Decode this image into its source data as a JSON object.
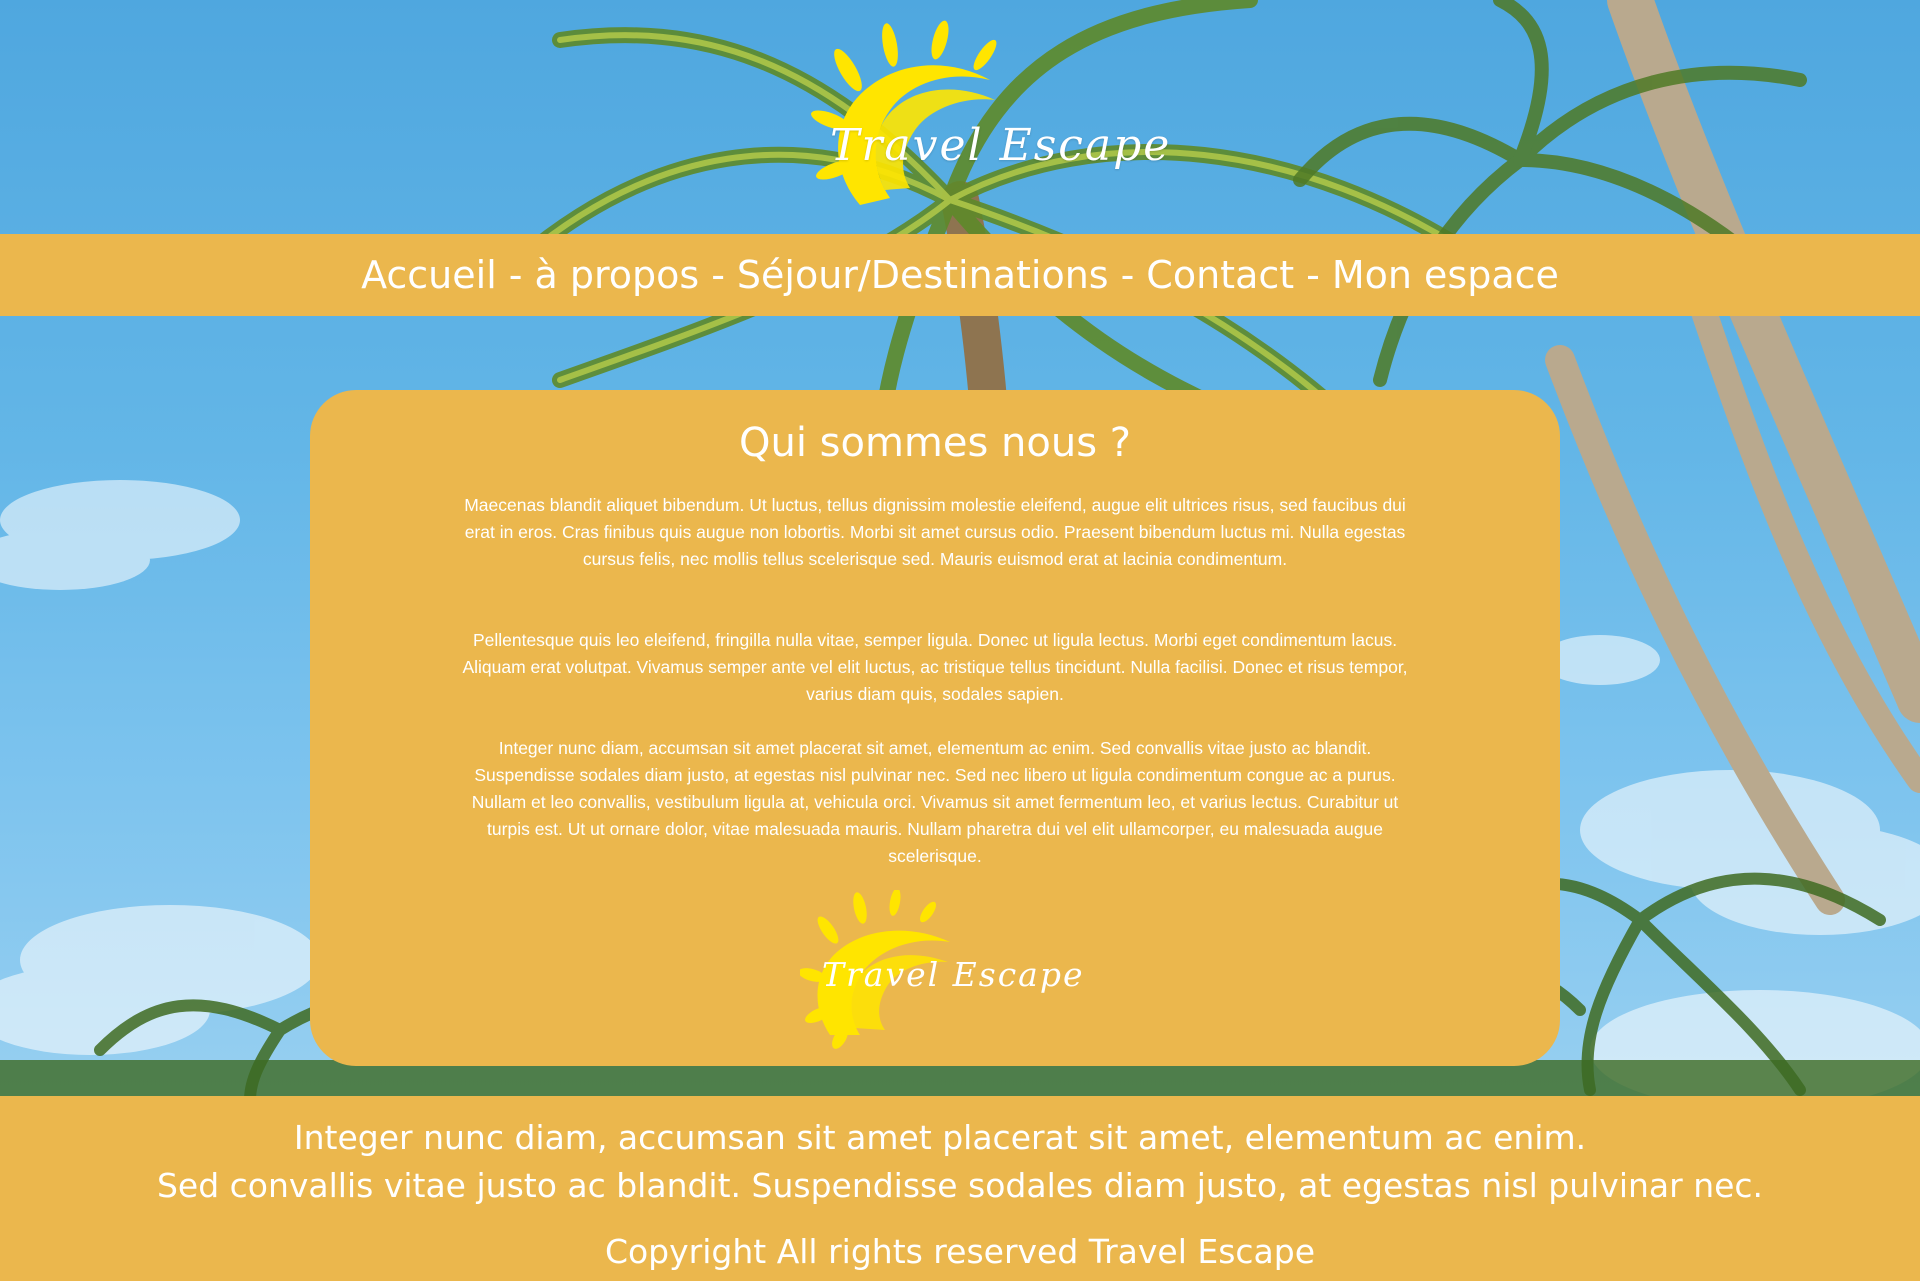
{
  "brand": {
    "name": "Travel Escape",
    "accent_color": "#ebb74d",
    "logo_sun_color": "#ffe500"
  },
  "nav": {
    "items": [
      {
        "label": "Accueil"
      },
      {
        "label": "à propos"
      },
      {
        "label": "Séjour/Destinations"
      },
      {
        "label": "Contact"
      },
      {
        "label": "Mon espace"
      }
    ],
    "separator": "-"
  },
  "main": {
    "title": "Qui sommes nous ?",
    "paragraphs": [
      "Maecenas blandit aliquet bibendum. Ut luctus, tellus dignissim molestie eleifend, augue elit ultrices risus, sed faucibus dui erat in eros. Cras finibus quis augue non lobortis. Morbi sit amet cursus odio. Praesent bibendum luctus mi. Nulla egestas cursus felis, nec mollis tellus scelerisque sed. Mauris euismod erat at lacinia condimentum.",
      "Pellentesque quis leo eleifend, fringilla nulla vitae, semper ligula. Donec ut ligula lectus. Morbi eget condimentum lacus. Aliquam erat volutpat. Vivamus semper ante vel elit luctus, ac tristique tellus tincidunt. Nulla facilisi. Donec et risus tempor, varius diam quis, sodales sapien.",
      "Integer nunc diam, accumsan sit amet placerat sit amet, elementum ac enim. Sed convallis vitae justo ac blandit. Suspendisse sodales diam justo, at egestas nisl pulvinar nec. Sed nec libero ut ligula condimentum congue ac a purus. Nullam et leo convallis, vestibulum ligula at, vehicula orci. Vivamus sit amet fermentum leo, et varius lectus. Curabitur ut turpis est. Ut ut ornare dolor, vitae malesuada mauris. Nullam pharetra dui vel elit ullamcorper, eu malesuada augue scelerisque."
    ]
  },
  "footer": {
    "line1": "Integer nunc diam, accumsan sit amet placerat sit amet, elementum ac enim.",
    "line2": "Sed convallis vitae justo ac blandit. Suspendisse sodales diam justo, at egestas nisl pulvinar nec.",
    "copyright": "Copyright All rights reserved Travel Escape"
  }
}
